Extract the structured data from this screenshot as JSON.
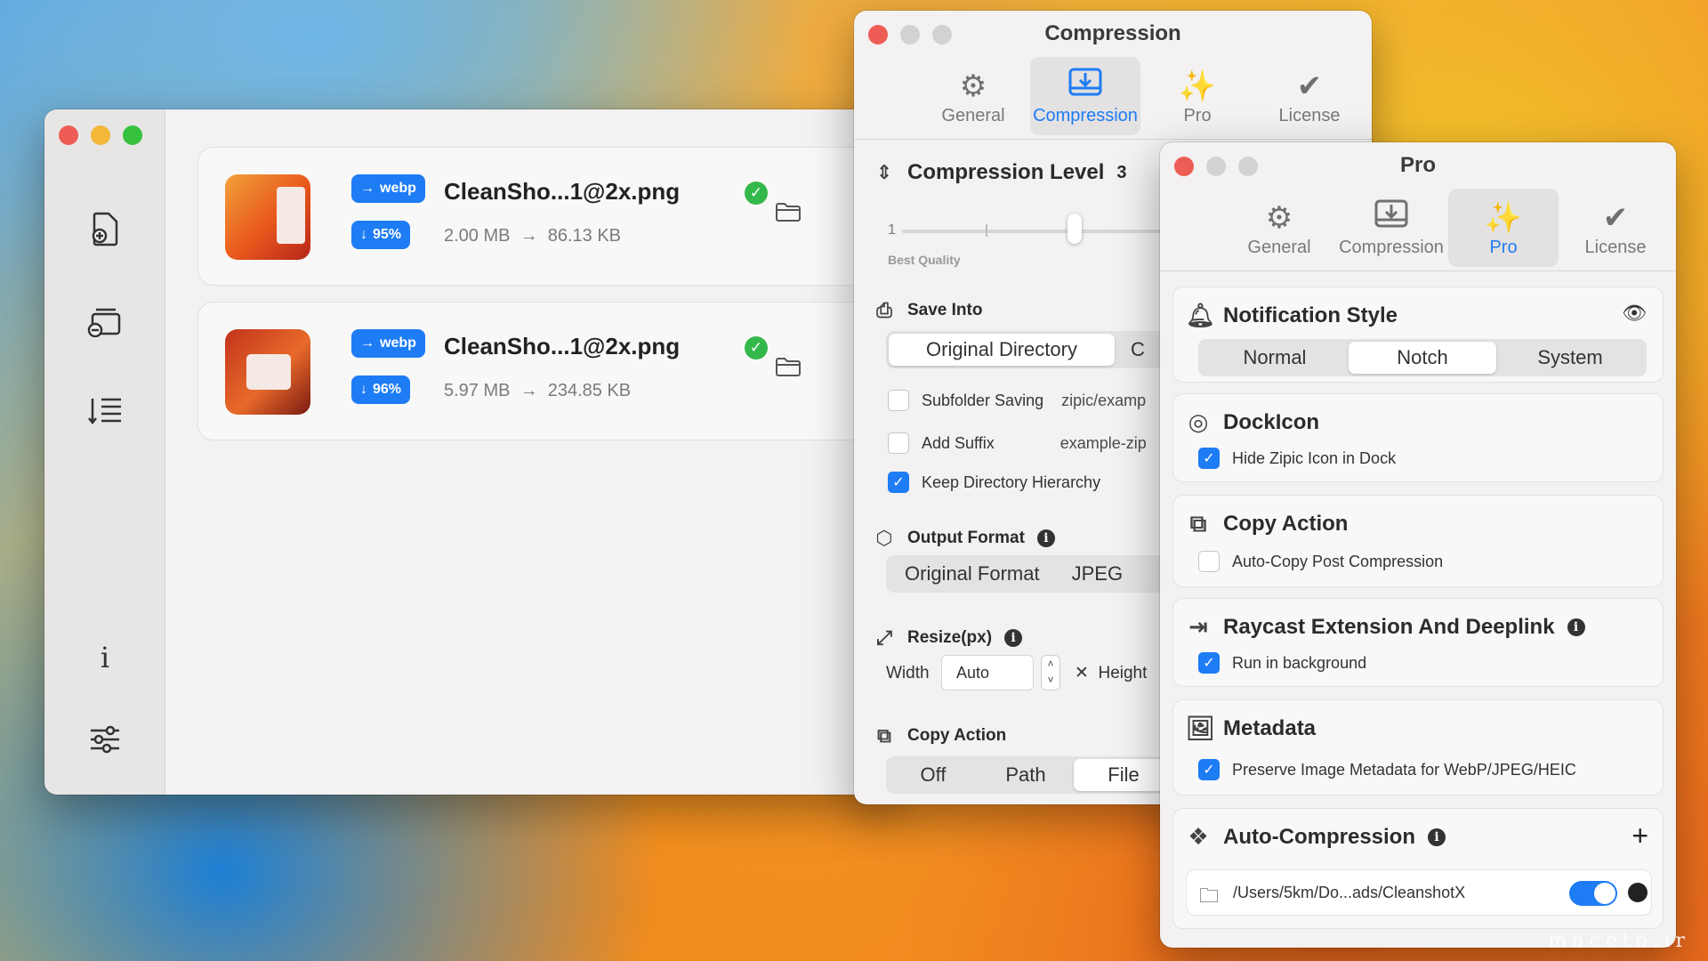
{
  "main_window": {
    "files": [
      {
        "format": "webp",
        "name": "CleanSho...1@2x.png",
        "reduction": "95%",
        "original_size": "2.00 MB",
        "compressed_size": "86.13 KB"
      },
      {
        "format": "webp",
        "name": "CleanSho...1@2x.png",
        "reduction": "96%",
        "original_size": "5.97 MB",
        "compressed_size": "234.85 KB"
      }
    ],
    "sidebar_info": "i"
  },
  "compression_window": {
    "title": "Compression",
    "tabs": [
      "General",
      "Compression",
      "Pro",
      "License"
    ],
    "active_tab": "Compression",
    "level": {
      "label": "Compression Level",
      "value": "3",
      "slider_min": "1",
      "hint": "Best Quality"
    },
    "save_into": {
      "label": "Save Into",
      "options": [
        "Original Directory",
        "C"
      ],
      "selected": "Original Directory"
    },
    "subfolder": {
      "label": "Subfolder Saving",
      "value": "zipic/examp",
      "checked": false
    },
    "suffix": {
      "label": "Add Suffix",
      "value": "example-zip",
      "checked": false
    },
    "keep_hierarchy": {
      "label": "Keep Directory Hierarchy",
      "checked": true
    },
    "output_format": {
      "label": "Output Format",
      "options": [
        "Original Format",
        "JPEG"
      ]
    },
    "resize": {
      "label": "Resize(px)",
      "width_label": "Width",
      "width_value": "Auto",
      "height_label": "Height"
    },
    "copy_action": {
      "label": "Copy Action",
      "options": [
        "Off",
        "Path",
        "File"
      ],
      "selected": "File"
    }
  },
  "pro_window": {
    "title": "Pro",
    "tabs": [
      "General",
      "Compression",
      "Pro",
      "License"
    ],
    "active_tab": "Pro",
    "notification": {
      "label": "Notification Style",
      "options": [
        "Normal",
        "Notch",
        "System"
      ],
      "selected": "Notch"
    },
    "dock_icon": {
      "label": "DockIcon",
      "option": "Hide Zipic Icon in Dock",
      "checked": true
    },
    "copy_action": {
      "label": "Copy Action",
      "option": "Auto-Copy Post Compression",
      "checked": false
    },
    "raycast": {
      "label": "Raycast Extension And Deeplink",
      "option": "Run in background",
      "checked": true
    },
    "metadata": {
      "label": "Metadata",
      "option": "Preserve Image Metadata for WebP/JPEG/HEIC",
      "checked": true
    },
    "auto_compression": {
      "label": "Auto-Compression",
      "path": "/Users/5km/Do...ads/CleanshotX",
      "enabled": true
    }
  },
  "watermark": {
    "text": "maceto.ir"
  },
  "colors": {
    "accent": "#1e7cf5",
    "success": "#35b84b"
  }
}
